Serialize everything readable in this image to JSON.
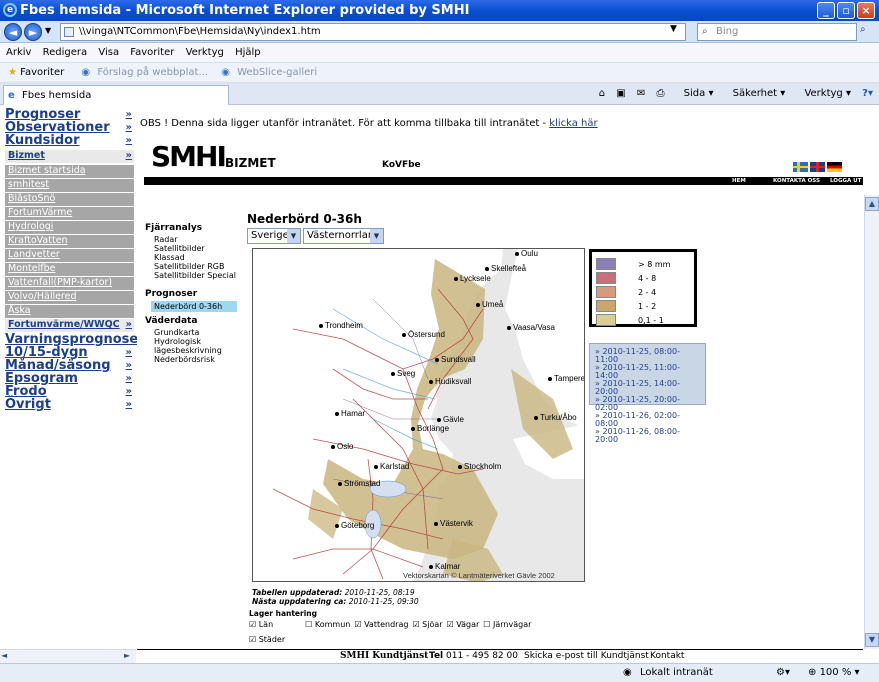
{
  "window": {
    "title": "Fbes hemsida - Microsoft Internet Explorer provided by SMHI"
  },
  "browser": {
    "address": "\\\\vinga\\NTCommon\\Fbe\\Hemsida\\Ny\\index1.htm",
    "search_placeholder": "Bing",
    "menu": [
      "Arkiv",
      "Redigera",
      "Visa",
      "Favoriter",
      "Verktyg",
      "Hjälp"
    ],
    "favorites_label": "Favoriter",
    "fav_items": [
      "Förslag på webbplat...",
      "WebSlice-galleri"
    ],
    "tab_title": "Fbes hemsida",
    "cmd": [
      "Sida",
      "Säkerhet",
      "Verktyg"
    ]
  },
  "sidebar": {
    "big_top": [
      {
        "label": "Prognoser"
      },
      {
        "label": "Observationer"
      },
      {
        "label": "Kundsidor"
      }
    ],
    "bizmet_label": "Bizmet",
    "sub_items": [
      "Bizmet startsida",
      "smhitest",
      "BlåstoSnö",
      "FortumVärme",
      "Hydrologi",
      "KraftoVatten",
      "Landvetter",
      "Montelfbe",
      "Vattenfall(PMP-kartor)",
      "Volvo/Hällered",
      "Åska"
    ],
    "fortum_wwqc": "Fortumvärme/WWQC",
    "big_bottom": [
      {
        "label": "Varningsprognoser"
      },
      {
        "label": "10/15-dygn"
      },
      {
        "label": "Månad/säsong"
      },
      {
        "label": "Epsogram"
      },
      {
        "label": "Frodo"
      },
      {
        "label": "Övrigt"
      }
    ],
    "arrow": "»"
  },
  "notice": {
    "text": "OBS ! Denna sida ligger utanför intranätet. För att komma tillbaka till intranätet - ",
    "link": "klicka här"
  },
  "header": {
    "logo": "SMHI",
    "logo_sub": "BIZMET",
    "center_text": "KoVFbe",
    "nav": [
      "HEM",
      "KONTAKTA OSS",
      "LOGGA UT"
    ]
  },
  "leftmenu": {
    "heading1": "Fjärranalys",
    "items1": [
      "Radar",
      "Satellitbilder",
      "Klassad",
      "Satellitbilder RGB",
      "Satellitbilder Special"
    ],
    "heading2": "Prognoser",
    "active": "Nederbörd 0-36h",
    "heading3": "Väderdata",
    "items3": [
      "Grundkarta",
      "Hydrologisk",
      "lägesbeskrivning",
      "Nederbördsrisk"
    ]
  },
  "main": {
    "title": "Nederbörd 0-36h",
    "select1": "Sverige",
    "select2": "Västernorrland",
    "updated_label": "Tabellen uppdaterad:",
    "updated_value": "2010-11-25, 08:19",
    "next_label": "Nästa uppdatering ca:",
    "next_value": "2010-11-25, 09:30",
    "layers_label": "Lager hantering",
    "layers": [
      {
        "label": "Län",
        "checked": true
      },
      {
        "label": "Kommun",
        "checked": false
      },
      {
        "label": "Vattendrag",
        "checked": true
      },
      {
        "label": "Sjöar",
        "checked": true
      },
      {
        "label": "Vägar",
        "checked": true
      },
      {
        "label": "Järnvägar",
        "checked": false
      },
      {
        "label": "Städer",
        "checked": true
      }
    ]
  },
  "map": {
    "credit": "Vektorskartan © Lantmäteriverket Gävle 2002",
    "cities": [
      "Oulu",
      "Skellefteå",
      "Lycksele",
      "Umeå",
      "Trondheim",
      "Östersund",
      "Vaasa/Vasa",
      "Sundsvall",
      "Sveg",
      "Hudiksvall",
      "Tampere",
      "Hamar",
      "Gävle",
      "Turku/Åbo",
      "Borlänge",
      "Oslo",
      "Karlstad",
      "Stockholm",
      "Strömstad",
      "Göteborg",
      "Västervik",
      "Kalmar"
    ]
  },
  "legend": [
    {
      "label": "> 8 mm",
      "color": "#8c7fb7"
    },
    {
      "label": "4 - 8",
      "color": "#c8707a"
    },
    {
      "label": "2 - 4",
      "color": "#d79a7c"
    },
    {
      "label": "1 - 2",
      "color": "#c9a66b"
    },
    {
      "label": "0,1 - 1",
      "color": "#d7cf95"
    }
  ],
  "dates": [
    "» 2010-11-25, 08:00-11:00",
    "» 2010-11-25, 11:00-14:00",
    "» 2010-11-25, 14:00-20:00",
    "» 2010-11-25, 20:00-02:00",
    "» 2010-11-26, 02:00-08:00",
    "» 2010-11-26, 08:00-20:00"
  ],
  "footer": {
    "brand": "SMHI Kundtjänst",
    "tel_label": "Tel",
    "tel": "011 - 495 82 00",
    "mail": "Skicka e-post till Kundtjänst",
    "contact": "Kontakt"
  },
  "status": {
    "zone": "Lokalt intranät",
    "zoom": "100 %"
  }
}
